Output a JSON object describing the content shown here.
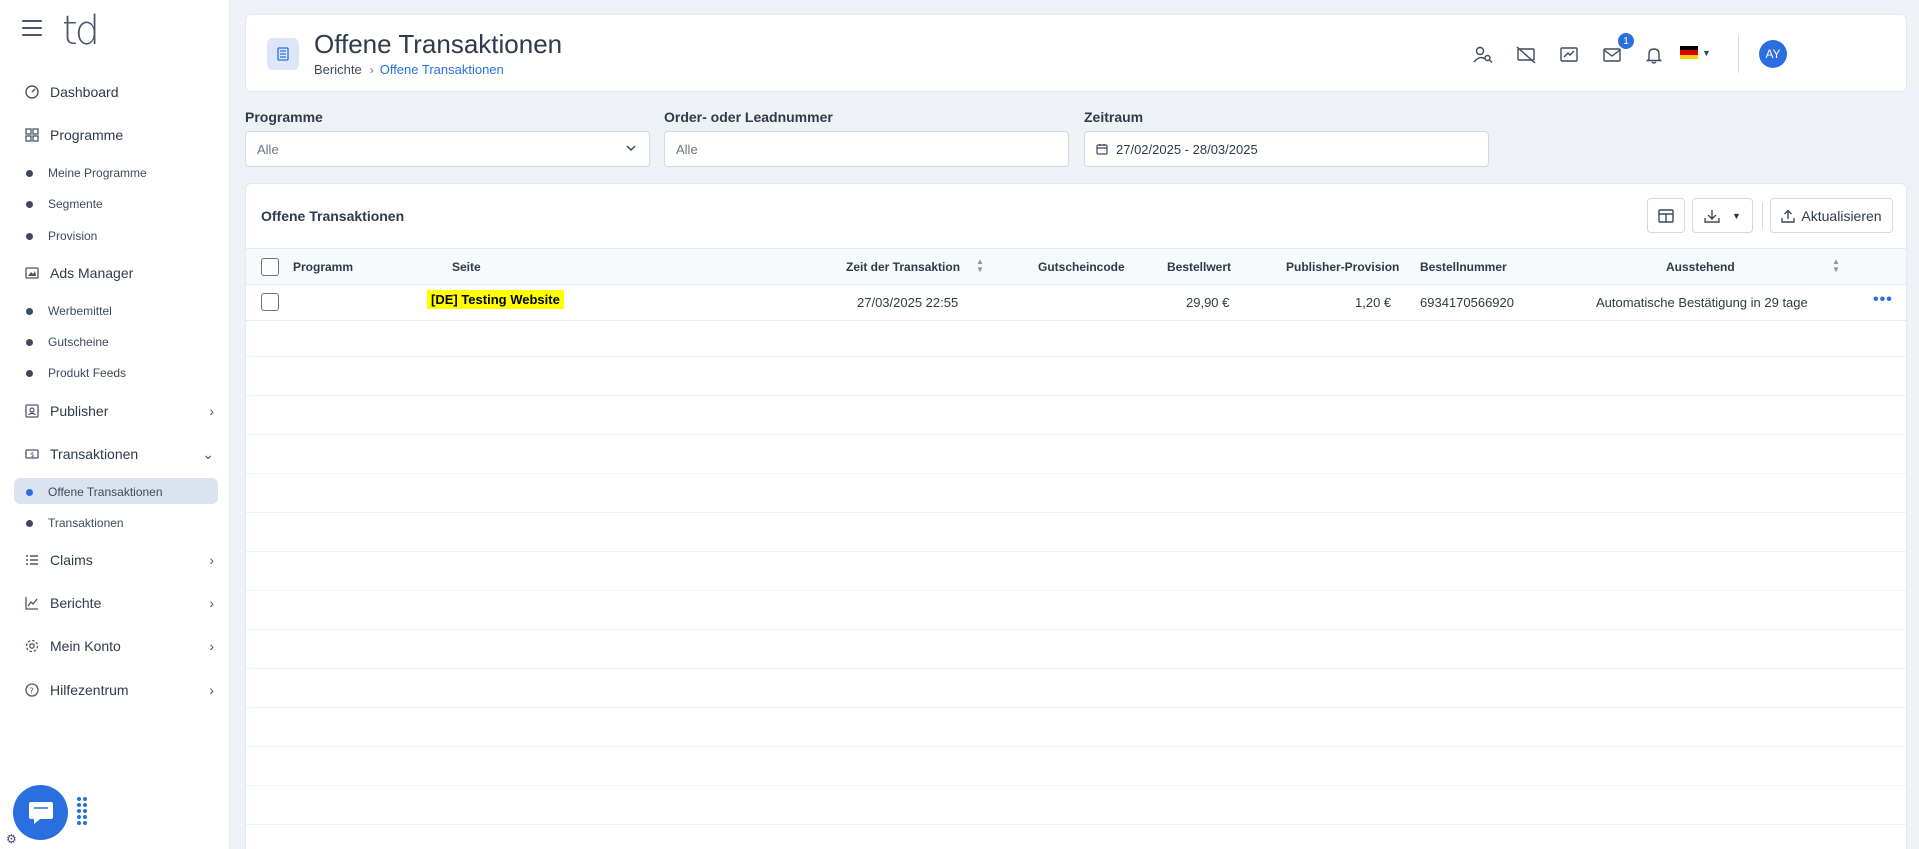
{
  "app": {
    "logo": "td"
  },
  "sidebar": {
    "items": [
      {
        "label": "Dashboard",
        "icon": "dashboard-icon"
      },
      {
        "label": "Programme",
        "icon": "grid-icon",
        "children": [
          "Meine Programme",
          "Segmente",
          "Provision"
        ]
      },
      {
        "label": "Ads Manager",
        "icon": "image-icon",
        "children": [
          "Werbemittel",
          "Gutscheine",
          "Produkt Feeds"
        ]
      },
      {
        "label": "Publisher",
        "icon": "id-card-icon"
      },
      {
        "label": "Transaktionen",
        "icon": "money-icon",
        "children": [
          "Offene Transaktionen",
          "Transaktionen"
        ]
      },
      {
        "label": "Claims",
        "icon": "list-icon"
      },
      {
        "label": "Berichte",
        "icon": "chart-icon"
      },
      {
        "label": "Mein Konto",
        "icon": "gear-icon"
      },
      {
        "label": "Hilfezentrum",
        "icon": "help-icon"
      }
    ]
  },
  "header": {
    "title": "Offene Transaktionen",
    "breadcrumb": [
      "Berichte",
      "Offene Transaktionen"
    ],
    "mail_badge": "1",
    "avatar_initials": "AY",
    "language": "de"
  },
  "filters": {
    "programme": {
      "label": "Programme",
      "value": "Alle"
    },
    "order": {
      "label": "Order- oder Leadnummer",
      "placeholder": "Alle"
    },
    "zeitraum": {
      "label": "Zeitraum",
      "value": "27/02/2025 - 28/03/2025"
    }
  },
  "table": {
    "title": "Offene Transaktionen",
    "refresh_label": "Aktualisieren",
    "columns": [
      "Programm",
      "Seite",
      "Zeit der Transaktion",
      "Gutscheincode",
      "Bestellwert",
      "Publisher-Provision",
      "Bestellnummer",
      "Ausstehend"
    ],
    "rows": [
      {
        "programm": "",
        "seite": "[DE] Testing Website",
        "zeit": "27/03/2025 22:55",
        "gutscheincode": "",
        "bestellwert": "29,90 €",
        "provision": "1,20 €",
        "bestellnummer": "6934170566920",
        "ausstehend": "Automatische Bestätigung in 29 tage"
      }
    ]
  },
  "colors": {
    "accent": "#2a6fe0",
    "highlight": "#ffff00"
  }
}
